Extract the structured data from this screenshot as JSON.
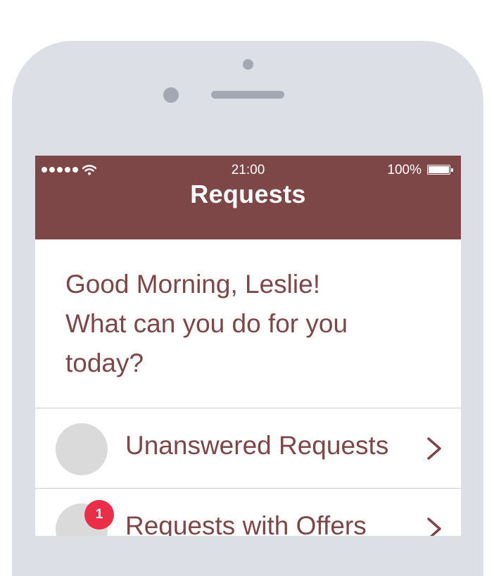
{
  "status_bar": {
    "time": "21:00",
    "battery": "100%",
    "signal_icon": "signal-dots-icon",
    "wifi_icon": "wifi-icon",
    "battery_icon": "battery-icon"
  },
  "nav": {
    "title": "Requests",
    "background": "#7d4647"
  },
  "greeting": {
    "line1": "Good Morning, Leslie!",
    "line2": "What can you do for you",
    "line3": "today?"
  },
  "menu": [
    {
      "label": "Unanswered Requests",
      "badge": ""
    },
    {
      "label": "Requests with Offers",
      "badge": "1"
    }
  ],
  "colors": {
    "accent": "#7d4647",
    "badge": "#ea2e48",
    "device": "#dcdfe5"
  }
}
